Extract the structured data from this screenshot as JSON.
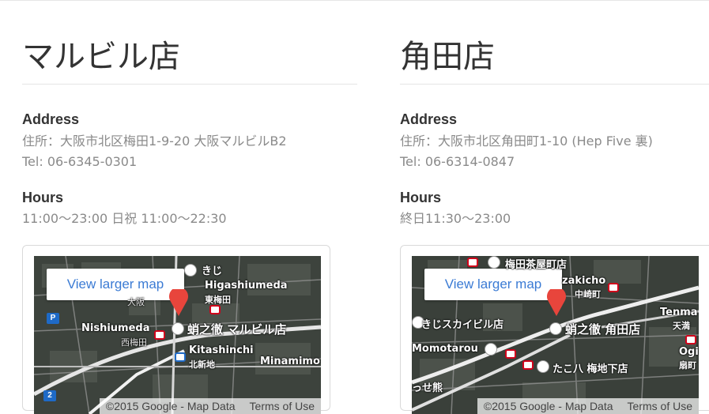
{
  "stores": [
    {
      "title": "マルビル店",
      "address_label": "Address",
      "address": "住所：大阪市北区梅田1-9-20 大阪マルビルB2",
      "tel": "Tel: 06-6345-0301",
      "hours_label": "Hours",
      "hours": "11:00〜23:00 日祝 11:00〜22:30",
      "map": {
        "larger_map_label": "View larger map",
        "copyright": "©2015 Google - Map Data",
        "terms_label": "Terms of Use",
        "marker_label": "蛸之徹 マルビル店",
        "place_labels": [
          "きじ",
          "Higashiumeda",
          "東梅田",
          "大阪",
          "Nishiumeda",
          "西梅田",
          "Kitashinchi",
          "北新地",
          "Minamimo"
        ],
        "route_badge": "2"
      }
    },
    {
      "title": "角田店",
      "address_label": "Address",
      "address": "住所：大阪市北区角田町1-10 (Hep Five 裏)",
      "tel": "Tel: 06-6314-0847",
      "hours_label": "Hours",
      "hours": "終日11:30〜23:00",
      "map": {
        "larger_map_label": "View larger map",
        "copyright": "©2015 Google - Map Data",
        "terms_label": "Terms of Use",
        "marker_label": "蛸之徹 角田店",
        "place_labels": [
          "梅田茶屋町店",
          "zakicho",
          "中崎町",
          "きじスカイビル店",
          "Momotarou",
          "たこ八 梅地下店",
          "Tenma",
          "天満",
          "Ogi",
          "扇町",
          "っせ熊"
        ]
      }
    }
  ],
  "colors": {
    "link": "#3b7bd4",
    "marker": "#e8453c",
    "text_muted": "#8a8a8a",
    "heading": "#333333"
  }
}
